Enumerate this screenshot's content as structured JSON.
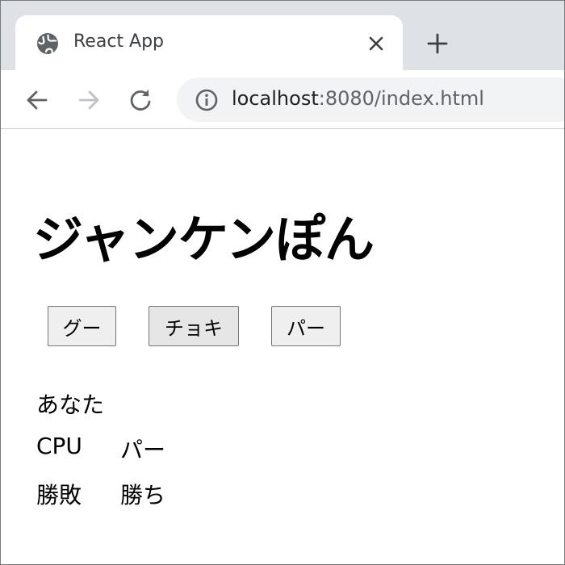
{
  "browser": {
    "tab": {
      "title": "React App",
      "icon": "globe-icon",
      "close_icon": "close-icon"
    },
    "new_tab_icon": "plus-icon",
    "toolbar": {
      "back_icon": "arrow-left-icon",
      "forward_icon": "arrow-right-icon",
      "reload_icon": "reload-icon",
      "site_info_icon": "info-icon",
      "url_host": "localhost",
      "url_rest": ":8080/index.html"
    }
  },
  "page": {
    "heading": "ジャンケンぽん",
    "buttons": [
      {
        "label": "グー"
      },
      {
        "label": "チョキ"
      },
      {
        "label": "パー"
      }
    ],
    "results": [
      {
        "label": "あなた",
        "value": ""
      },
      {
        "label": "CPU",
        "value": "パー"
      },
      {
        "label": "勝敗",
        "value": "勝ち"
      }
    ]
  },
  "colors": {
    "tab_strip": "#dee1e6",
    "omnibox": "#f1f3f4",
    "button_bg": "#efefef",
    "button_border": "#767676"
  }
}
